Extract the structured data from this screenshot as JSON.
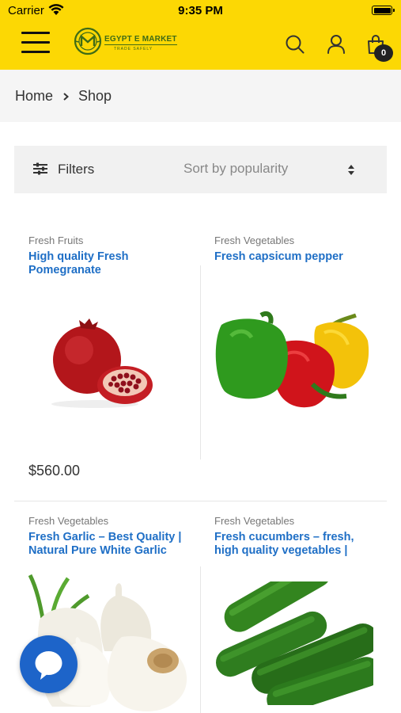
{
  "status_bar": {
    "carrier": "Carrier",
    "time": "9:35 PM"
  },
  "header": {
    "logo_text": "EGYPT E MARKET",
    "logo_tagline": "TRADE SAFELY",
    "cart_count": "0",
    "icons": [
      "menu-icon",
      "search-icon",
      "user-icon",
      "shopping-bag-icon"
    ],
    "brand_color": "#fcd804"
  },
  "breadcrumb": {
    "home": "Home",
    "current": "Shop"
  },
  "toolbar": {
    "filters_label": "Filters",
    "sort_label": "Sort by popularity"
  },
  "products": [
    {
      "category": "Fresh Fruits",
      "title": "High quality Fresh Pomegranate",
      "price": "$560.00",
      "image": "pomegranate"
    },
    {
      "category": "Fresh Vegetables",
      "title": "Fresh capsicum pepper",
      "price": "",
      "image": "bell-peppers"
    },
    {
      "category": "Fresh Vegetables",
      "title": "Fresh Garlic – Best Quality | Natural Pure White Garlic",
      "price": "",
      "image": "garlic"
    },
    {
      "category": "Fresh Vegetables",
      "title": "Fresh cucumbers – fresh, high quality vegetables |",
      "price": "",
      "image": "cucumbers"
    }
  ],
  "colors": {
    "link_blue": "#1f6fc6",
    "chat_blue": "#1d64c9"
  }
}
